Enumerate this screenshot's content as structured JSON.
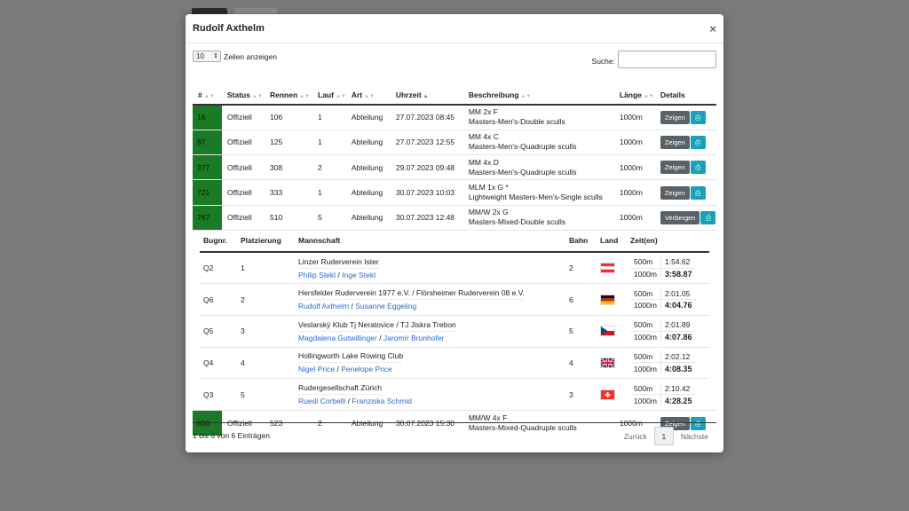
{
  "modal": {
    "title": "Rudolf Axthelm",
    "close": "×"
  },
  "controls": {
    "length_value": "10",
    "length_label": "Zeilen anzeigen",
    "search_label": "Suche:",
    "search_value": ""
  },
  "columns": [
    "#",
    "Status",
    "Rennen",
    "Lauf",
    "Art",
    "Uhrzeit",
    "Beschreibung",
    "Länge",
    "Details"
  ],
  "rows": [
    {
      "bug": "16",
      "status": "Offiziell",
      "race": "106",
      "heat": "1",
      "type": "Abteilung",
      "time": "27.07.2023 08:45",
      "desc1": "MM 2x F",
      "desc2": "Masters-Men's-Double sculls",
      "length": "1000m",
      "btn": "Zeigen"
    },
    {
      "bug": "87",
      "status": "Offiziell",
      "race": "125",
      "heat": "1",
      "type": "Abteilung",
      "time": "27.07.2023 12:55",
      "desc1": "MM 4x C",
      "desc2": "Masters-Men's-Quadruple sculls",
      "length": "1000m",
      "btn": "Zeigen"
    },
    {
      "bug": "377",
      "status": "Offiziell",
      "race": "308",
      "heat": "2",
      "type": "Abteilung",
      "time": "29.07.2023 09:48",
      "desc1": "MM 4x D",
      "desc2": "Masters-Men's-Quadruple sculls",
      "length": "1000m",
      "btn": "Zeigen"
    },
    {
      "bug": "721",
      "status": "Offiziell",
      "race": "333",
      "heat": "1",
      "type": "Abteilung",
      "time": "30.07.2023 10:03",
      "desc1": "MLM 1x G *",
      "desc2": "Lightweight Masters-Men's-Single sculls",
      "length": "1000m",
      "btn": "Zeigen"
    },
    {
      "bug": "767",
      "status": "Offiziell",
      "race": "510",
      "heat": "5",
      "type": "Abteilung",
      "time": "30.07.2023 12:48",
      "desc1": "MM/W 2x G",
      "desc2": "Masters-Mixed-Double sculls",
      "length": "1000m",
      "btn": "Verbergen"
    }
  ],
  "detail": {
    "columns": [
      "Bugnr.",
      "Platzierung",
      "Mannschaft",
      "Bahn",
      "Land",
      "Zeit(en)"
    ],
    "entries": [
      {
        "bug": "Q2",
        "place": "1",
        "club": "Linzer Ruderverein Ister",
        "rower1": "Philip Stekl",
        "rower2": "Inge Stekl",
        "lane": "2",
        "flag": "austria-flag",
        "d1": "500m",
        "t1": "1:54.62",
        "d2": "1000m",
        "t2": "3:58.87"
      },
      {
        "bug": "Q6",
        "place": "2",
        "club": "Hersfelder Ruderverein 1977 e.V. / Flörsheimer Ruderverein 08 e.V.",
        "rower1": "Rudolf Axthelm",
        "rower2": "Susanne Eggeling",
        "lane": "6",
        "flag": "germany-flag",
        "d1": "500m",
        "t1": "2:01.05",
        "d2": "1000m",
        "t2": "4:04.76"
      },
      {
        "bug": "Q5",
        "place": "3",
        "club": "Veslarský Klub Tj Neratovice / TJ Jiskra Trebon",
        "rower1": "Magdalena Gutwillinger",
        "rower2": "Jaromír Brunhofer",
        "lane": "5",
        "flag": "czech-flag",
        "d1": "500m",
        "t1": "2:01.89",
        "d2": "1000m",
        "t2": "4:07.86"
      },
      {
        "bug": "Q4",
        "place": "4",
        "club": "Hollingworth Lake Rowing Club",
        "rower1": "Nigel Price",
        "rower2": "Penelope Price",
        "lane": "4",
        "flag": "uk-flag",
        "d1": "500m",
        "t1": "2:02.12",
        "d2": "1000m",
        "t2": "4:08.35"
      },
      {
        "bug": "Q3",
        "place": "5",
        "club": "Rudergesellschaft Zürich",
        "rower1": "Ruedi Corbelli",
        "rower2": "Franziska Schmid",
        "lane": "3",
        "flag": "swiss-flag",
        "d1": "500m",
        "t1": "2:10.42",
        "d2": "1000m",
        "t2": "4:28.25"
      }
    ]
  },
  "last_row": {
    "bug": "806",
    "status": "Offiziell",
    "race": "523",
    "heat": "2",
    "type": "Abteilung",
    "time": "30.07.2023 15:30",
    "desc1": "MM/W 4x F",
    "desc2": "Masters-Mixed-Quadruple sculls",
    "length": "1000m",
    "btn": "Zeigen"
  },
  "footer": {
    "info": "1 bis 6 von 6 Einträgen",
    "prev": "Zurück",
    "page": "1",
    "next": "Nächste"
  },
  "colors": {
    "bug_bg": "#1b7a26",
    "link": "#2a6bd0",
    "btn_grey": "#5a6268",
    "btn_teal": "#17a2b8"
  }
}
